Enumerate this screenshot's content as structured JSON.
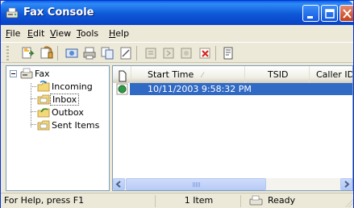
{
  "window": {
    "title": "Fax Console"
  },
  "menu": [
    {
      "label": "File",
      "accel": "F",
      "rest": "ile"
    },
    {
      "label": "Edit",
      "accel": "E",
      "rest": "dit"
    },
    {
      "label": "View",
      "accel": "V",
      "rest": "iew"
    },
    {
      "label": "Tools",
      "accel": "T",
      "rest": "ools"
    },
    {
      "label": "Help",
      "accel": "H",
      "rest": "elp"
    }
  ],
  "toolbar": {
    "buttons": [
      "send-fax-icon",
      "receive-fax-icon",
      "print-icon",
      "save-icon",
      "copy-icon",
      "properties-icon",
      "reply-icon",
      "forward-icon",
      "send-to-icon",
      "delete-icon",
      "cover-page-icon"
    ]
  },
  "tree": {
    "root": "Fax",
    "folders": [
      "Incoming",
      "Inbox",
      "Outbox",
      "Sent Items"
    ],
    "selected": "Inbox"
  },
  "list": {
    "columns": [
      "Start Time",
      "TSID",
      "Caller ID"
    ],
    "rows": [
      {
        "start_time": "10/11/2003 9:58:32 PM",
        "tsid": "",
        "caller_id": ""
      }
    ]
  },
  "status": {
    "help": "For Help, press F1",
    "count": "1 Item",
    "state": "Ready"
  },
  "colors": {
    "titlebar": "#0a5fe0",
    "selection": "#316ac5",
    "chrome": "#ece9d8"
  }
}
